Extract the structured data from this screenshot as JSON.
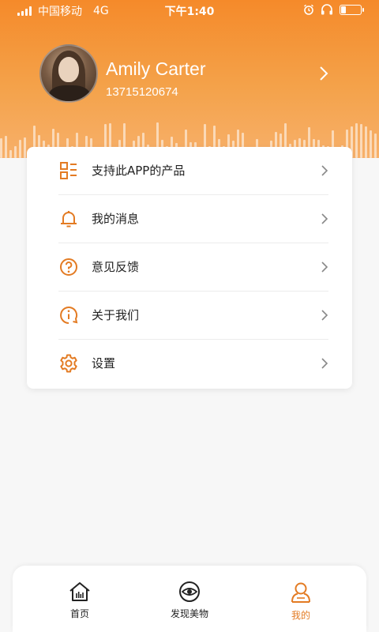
{
  "status_bar": {
    "carrier": "中国移动",
    "network": "4G",
    "time": "下午1:40"
  },
  "profile": {
    "name": "Amily Carter",
    "phone": "13715120674"
  },
  "menu": {
    "items": [
      {
        "label": "支持此APP的产品",
        "icon": "grid-list-icon"
      },
      {
        "label": "我的消息",
        "icon": "bell-icon"
      },
      {
        "label": "意见反馈",
        "icon": "question-circle-icon"
      },
      {
        "label": "关于我们",
        "icon": "info-circle-icon"
      },
      {
        "label": "设置",
        "icon": "gear-icon"
      }
    ]
  },
  "tabbar": {
    "tabs": [
      {
        "label": "首页",
        "icon": "home-icon"
      },
      {
        "label": "发现美物",
        "icon": "eye-icon"
      },
      {
        "label": "我的",
        "icon": "user-icon"
      }
    ],
    "active_tab": "我的"
  },
  "colors": {
    "accent": "#e37b23",
    "header_top": "#f58a2a",
    "header_bottom": "#f7b06a"
  }
}
